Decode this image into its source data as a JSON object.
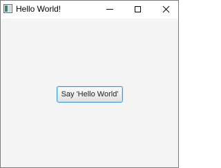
{
  "window": {
    "title": "Hello World!",
    "app_icon": "java-app-icon",
    "controls": {
      "minimize_icon": "minimize-icon",
      "maximize_icon": "maximize-icon",
      "close_icon": "close-icon"
    }
  },
  "main": {
    "button_label": "Say 'Hello World'"
  },
  "colors": {
    "background": "#f4f4f4",
    "focus_ring": "#3a9bd8"
  }
}
